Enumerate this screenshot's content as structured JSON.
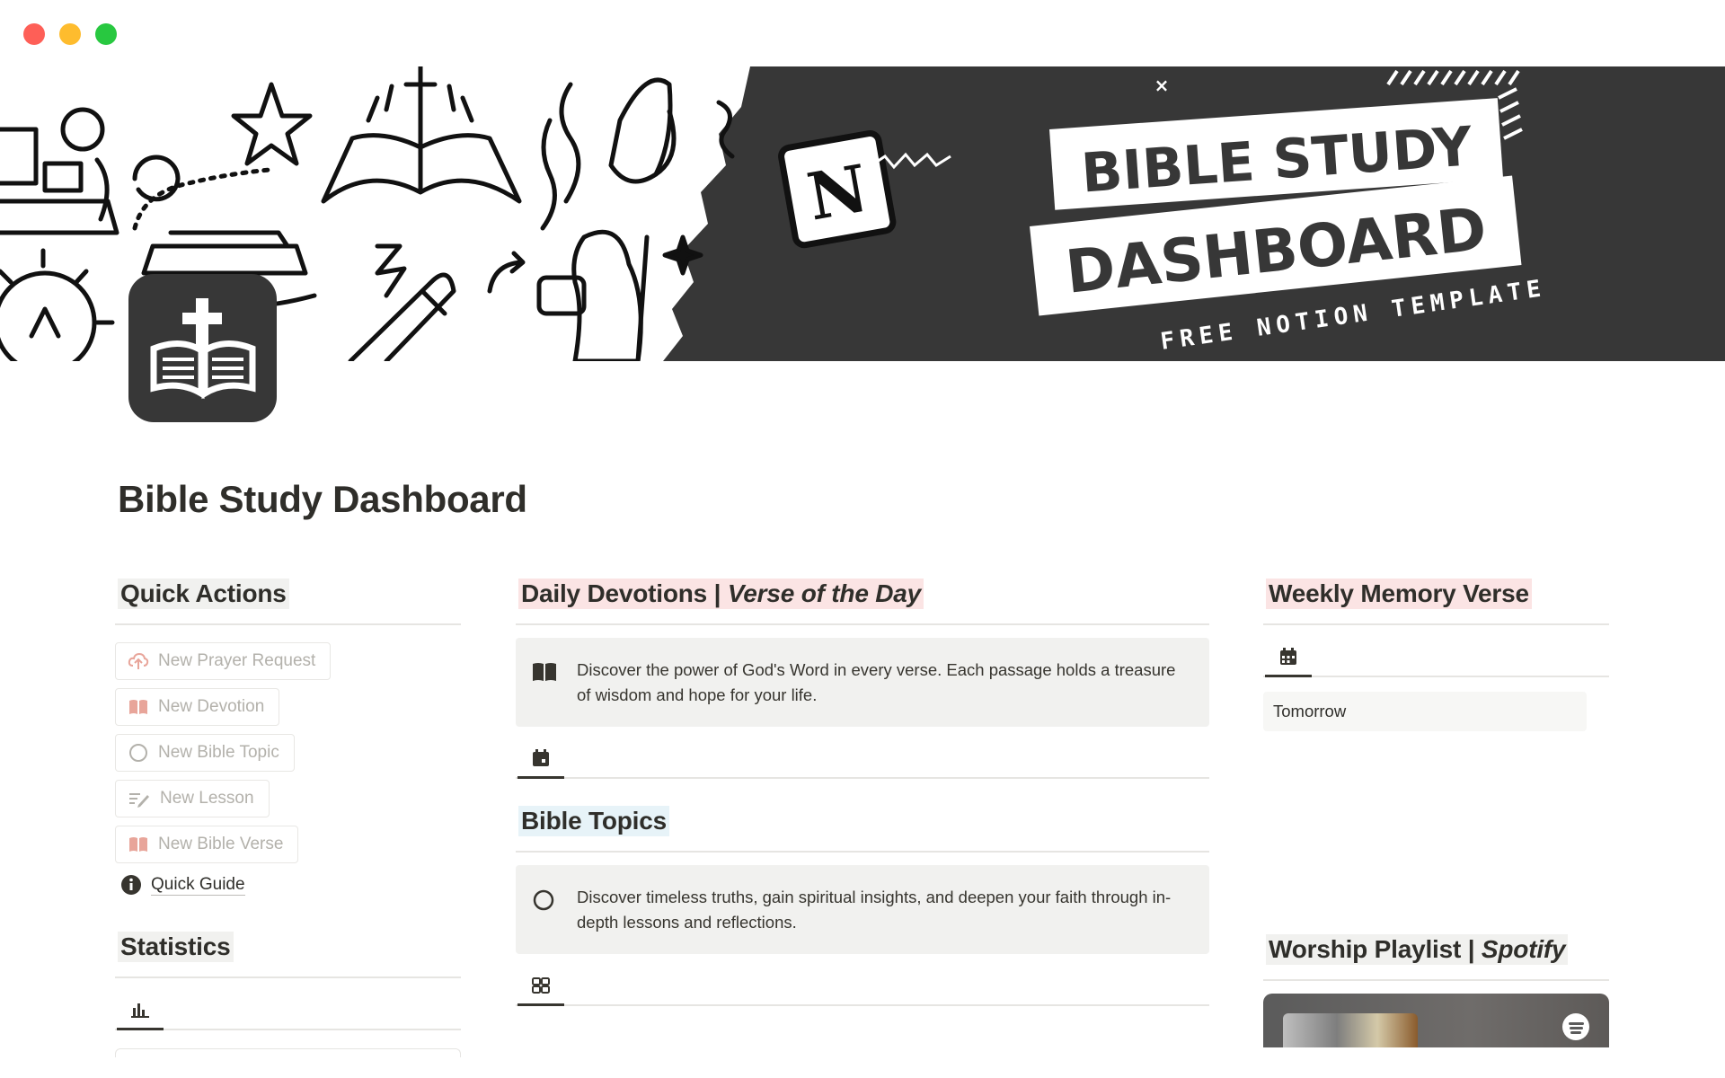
{
  "window": {
    "buttons": [
      "close",
      "minimize",
      "maximize"
    ]
  },
  "cover": {
    "banner_line1": "BIBLE STUDY",
    "banner_line2": "DASHBOARD",
    "banner_tagline": "FREE NOTION TEMPLATE",
    "notion_glyph": "N",
    "close_glyph": "×",
    "colors": {
      "dark_panel": "#373737",
      "banner_white": "#ffffff"
    }
  },
  "page": {
    "icon": "bible-cross-icon",
    "title": "Bible Study Dashboard"
  },
  "quick_actions": {
    "heading": "Quick Actions",
    "buttons": [
      {
        "label": "New Prayer Request",
        "icon": "cloud-upload-icon"
      },
      {
        "label": "New Devotion",
        "icon": "open-book-icon"
      },
      {
        "label": "New Bible Topic",
        "icon": "circle-icon"
      },
      {
        "label": "New Lesson",
        "icon": "pencil-lines-icon"
      },
      {
        "label": "New Bible Verse",
        "icon": "open-book-icon"
      }
    ],
    "guide_label": "Quick Guide",
    "guide_icon": "info-icon"
  },
  "statistics": {
    "heading": "Statistics",
    "view_icon": "bar-chart-icon"
  },
  "daily_devotions": {
    "heading_main": "Daily Devotions | ",
    "heading_italic": "Verse of the Day",
    "callout_icon": "book-icon",
    "callout_text": "Discover the power of God's Word in every verse. Each passage holds a treasure of wisdom and hope for your life.",
    "view_icon": "calendar-icon"
  },
  "bible_topics": {
    "heading": "Bible Topics",
    "callout_icon": "circle-icon",
    "callout_text": "Discover timeless truths, gain spiritual insights, and deepen your faith through in-depth lessons and reflections.",
    "view_icon": "gallery-icon"
  },
  "weekly_memory_verse": {
    "heading": "Weekly Memory Verse",
    "view_icon": "calendar-icon",
    "item": "Tomorrow"
  },
  "worship_playlist": {
    "heading_main": "Worship Playlist | ",
    "heading_italic": "Spotify",
    "embed_icon": "spotify-icon"
  },
  "colors": {
    "text": "#37352f",
    "highlight_gray": "#f1f1ef",
    "highlight_pink": "#fbe4e4",
    "highlight_blue": "#e7f3f8",
    "action_text": "#b3b1ab",
    "action_icon_pink": "#e8a59a"
  }
}
